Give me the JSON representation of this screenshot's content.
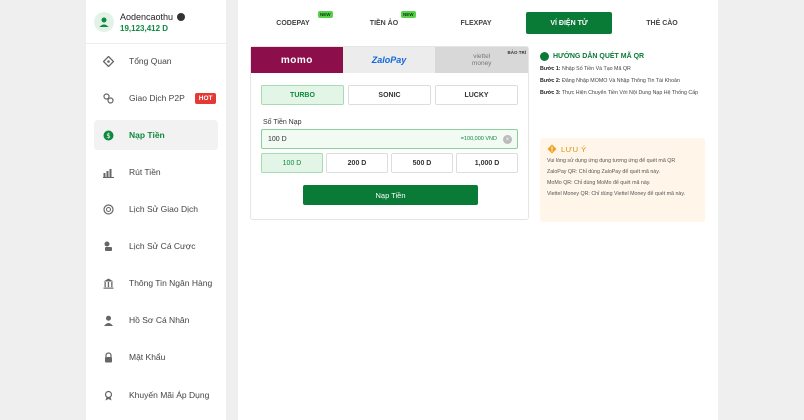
{
  "user": {
    "name": "Aodencaothu",
    "balance": "19,123,412 D"
  },
  "sidebar": {
    "items": [
      {
        "label": "Tổng Quan",
        "icon": "overview-icon"
      },
      {
        "label": "Giao Dịch P2P",
        "icon": "p2p-icon",
        "badge": "HOT"
      },
      {
        "label": "Nạp Tiền",
        "icon": "deposit-icon",
        "active": true
      },
      {
        "label": "Rút Tiền",
        "icon": "withdraw-icon"
      },
      {
        "label": "Lịch Sử Giao Dịch",
        "icon": "history-icon"
      },
      {
        "label": "Lịch Sử Cá Cược",
        "icon": "bet-history-icon"
      },
      {
        "label": "Thông Tin Ngân Hàng",
        "icon": "bank-icon"
      },
      {
        "label": "Hồ Sơ Cá Nhân",
        "icon": "profile-icon"
      },
      {
        "label": "Mật Khẩu",
        "icon": "lock-icon"
      },
      {
        "label": "Khuyến Mãi Áp Dụng",
        "icon": "promo-icon"
      }
    ]
  },
  "tabs": [
    {
      "label": "CODEPAY",
      "badge": "NEW"
    },
    {
      "label": "TIỀN ẢO",
      "badge": "NEW"
    },
    {
      "label": "FLEXPAY"
    },
    {
      "label": "VÍ ĐIỆN TỬ",
      "active": true
    },
    {
      "label": "THẺ CÀO"
    }
  ],
  "wallets": {
    "momo": "momo",
    "zalopay": "ZaloPay",
    "viettel_line1": "viettel",
    "viettel_line2": "money",
    "maintenance": "BẢO TRÌ"
  },
  "speeds": [
    "TURBO",
    "SONIC",
    "LUCKY"
  ],
  "amount": {
    "label": "Số Tiền Nạp",
    "value": "100 D",
    "hint": "=100,000 VND",
    "presets": [
      "100 D",
      "200 D",
      "500 D",
      "1,000 D"
    ]
  },
  "submit_label": "Nạp Tiền",
  "guide": {
    "title": "HƯỚNG DẪN QUÉT MÃ QR",
    "steps": [
      {
        "prefix": "Bước 1:",
        "text": " Nhập Số Tiền Và Tạo Mã QR"
      },
      {
        "prefix": "Bước 2:",
        "text": " Đăng Nhập MOMO Và Nhập Thông Tin Tài Khoản"
      },
      {
        "prefix": "Bước 3:",
        "text": " Thực Hiện Chuyển Tiền Với Nội Dung Nạp Hệ Thống Cấp"
      }
    ]
  },
  "notice": {
    "title": "LƯU Ý",
    "lines": [
      "Vui lòng sử dụng ứng dụng tương ứng để quét mã QR",
      "ZaloPay QR: Chỉ dùng ZaloPay để quét mã này.",
      "MoMo QR: Chỉ dùng MoMo để quét mã này.",
      "Viettel Money QR: Chỉ dùng Viettel Money để quét mã này."
    ]
  },
  "colors": {
    "accent": "#0a7a37",
    "momo": "#8c0f4b",
    "zalopay": "#1468d6",
    "hot": "#e53935",
    "new": "#57d14a",
    "notice_bg": "#fff6e9",
    "notice_title": "#e08a00"
  }
}
